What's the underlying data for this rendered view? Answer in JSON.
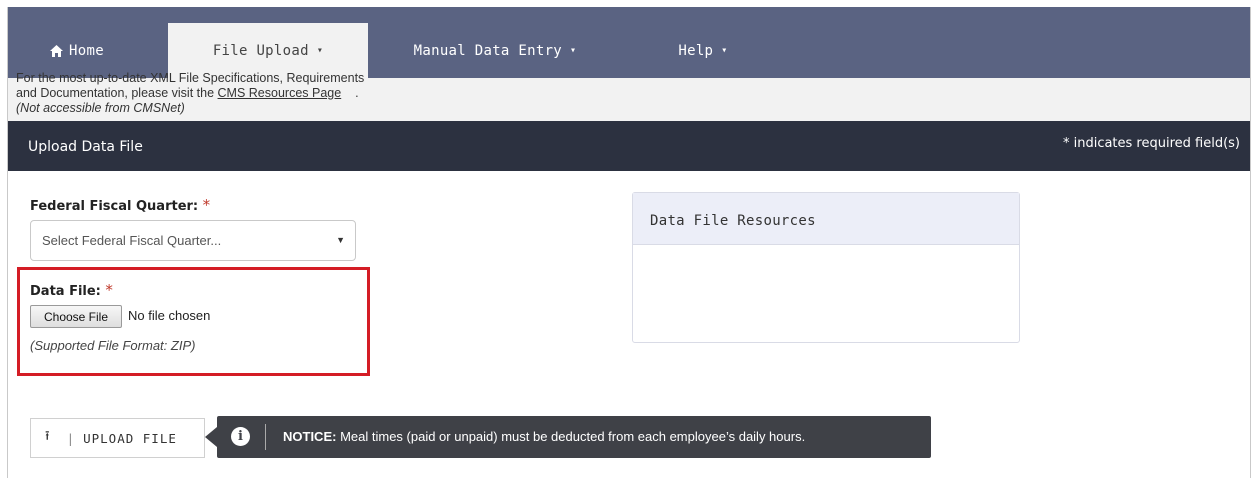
{
  "nav": {
    "home": "Home",
    "file_upload": "File Upload",
    "manual_entry": "Manual Data Entry",
    "help": "Help",
    "caret": "▾"
  },
  "section": {
    "title": "Upload Data File",
    "required_note": "* indicates required field(s)"
  },
  "form": {
    "fiscal_quarter_label": "Federal Fiscal Quarter:",
    "required_star": "*",
    "fiscal_quarter_placeholder": "Select Federal Fiscal Quarter...",
    "data_file_label": "Data File:",
    "choose_file_button": "Choose File",
    "no_file_text": "No file chosen",
    "supported_format": "(Supported File Format: ZIP)"
  },
  "resources": {
    "title": "Data File Resources",
    "body_text": "For the most up-to-date XML File Specifications, Requirements and Documentation, please visit the",
    "link_text": "CMS Resources Page",
    "after_link": ".",
    "note": "(Not accessible from CMSNet)"
  },
  "upload": {
    "button_label": "UPLOAD FILE",
    "notice_label": "NOTICE:",
    "notice_text": "Meal times (paid or unpaid) must be deducted from each employee’s daily hours."
  },
  "colors": {
    "nav_bg": "#5a6382",
    "header_bg": "#2c3140",
    "required": "#c0392b",
    "highlight_box": "#d41d25",
    "notice_bg": "#3f4147"
  }
}
